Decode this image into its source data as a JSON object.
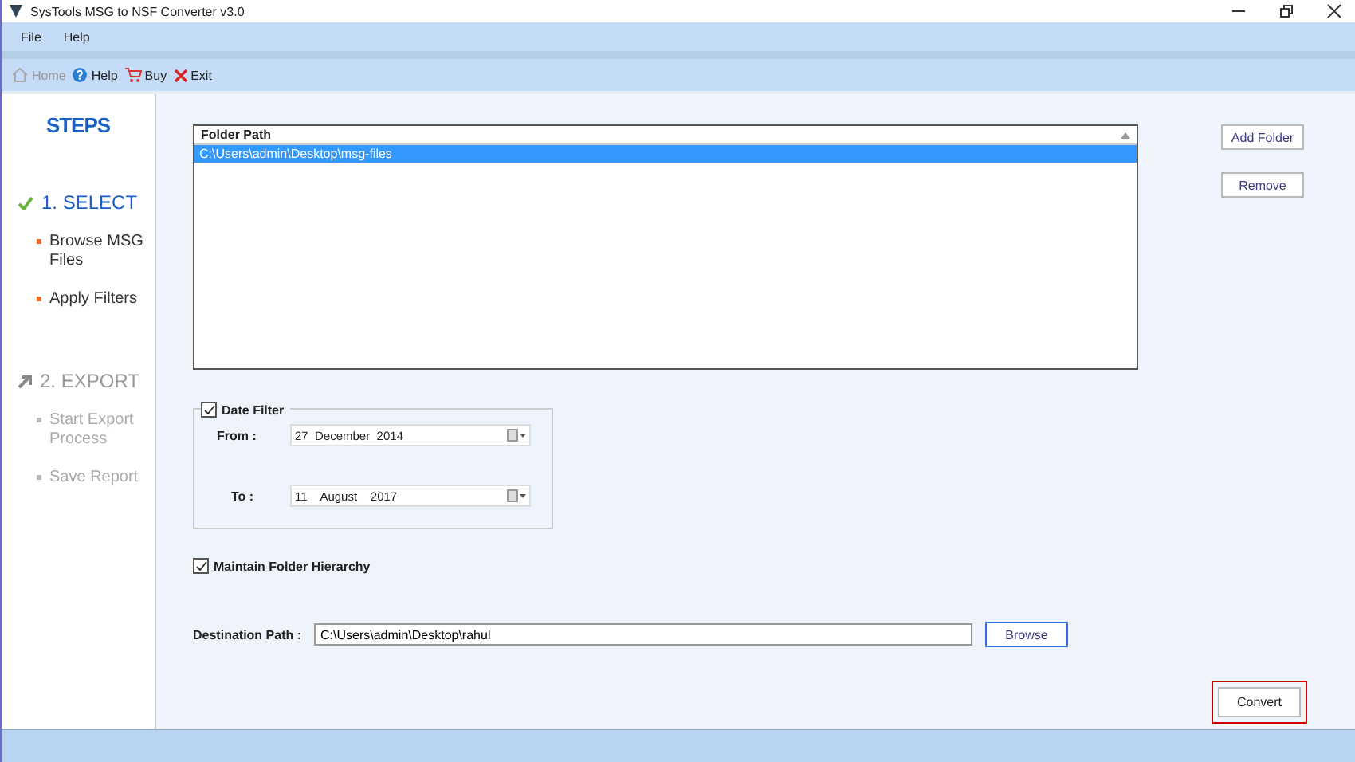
{
  "window": {
    "title": "SysTools MSG to NSF Converter v3.0"
  },
  "menu": [
    "File",
    "Help"
  ],
  "toolbar": [
    {
      "kind": "home",
      "label": "Home",
      "disabled": true
    },
    {
      "kind": "help",
      "label": "Help",
      "disabled": false
    },
    {
      "kind": "buy",
      "label": "Buy",
      "disabled": false
    },
    {
      "kind": "exit",
      "label": "Exit",
      "disabled": false
    }
  ],
  "sidebar": {
    "heading": "STEPS",
    "steps": [
      {
        "label": "1. SELECT",
        "active": true,
        "substeps": [
          {
            "label": "Browse MSG Files",
            "active": true
          },
          {
            "label": "Apply Filters",
            "active": true
          }
        ]
      },
      {
        "label": "2. EXPORT",
        "active": false,
        "substeps": [
          {
            "label": "Start Export Process",
            "active": false
          },
          {
            "label": "Save Report",
            "active": false
          }
        ]
      }
    ]
  },
  "folder_list": {
    "column": "Folder Path",
    "rows": [
      {
        "path": "C:\\Users\\admin\\Desktop\\msg-files",
        "selected": true
      }
    ]
  },
  "folder_buttons": [
    "Add Folder",
    "Remove"
  ],
  "date_filter": {
    "label": "Date Filter",
    "checked": true,
    "from_label": "From :",
    "from": "27  December  2014",
    "to_label": "To :",
    "to": "11    August    2017"
  },
  "hierarchy": {
    "label": "Maintain Folder Hierarchy",
    "checked": true
  },
  "destination": {
    "label": "Destination Path  :",
    "value": "C:\\Users\\admin\\Desktop\\rahul",
    "button": "Browse"
  },
  "convert_button": {
    "label": "Convert",
    "focused": true
  }
}
